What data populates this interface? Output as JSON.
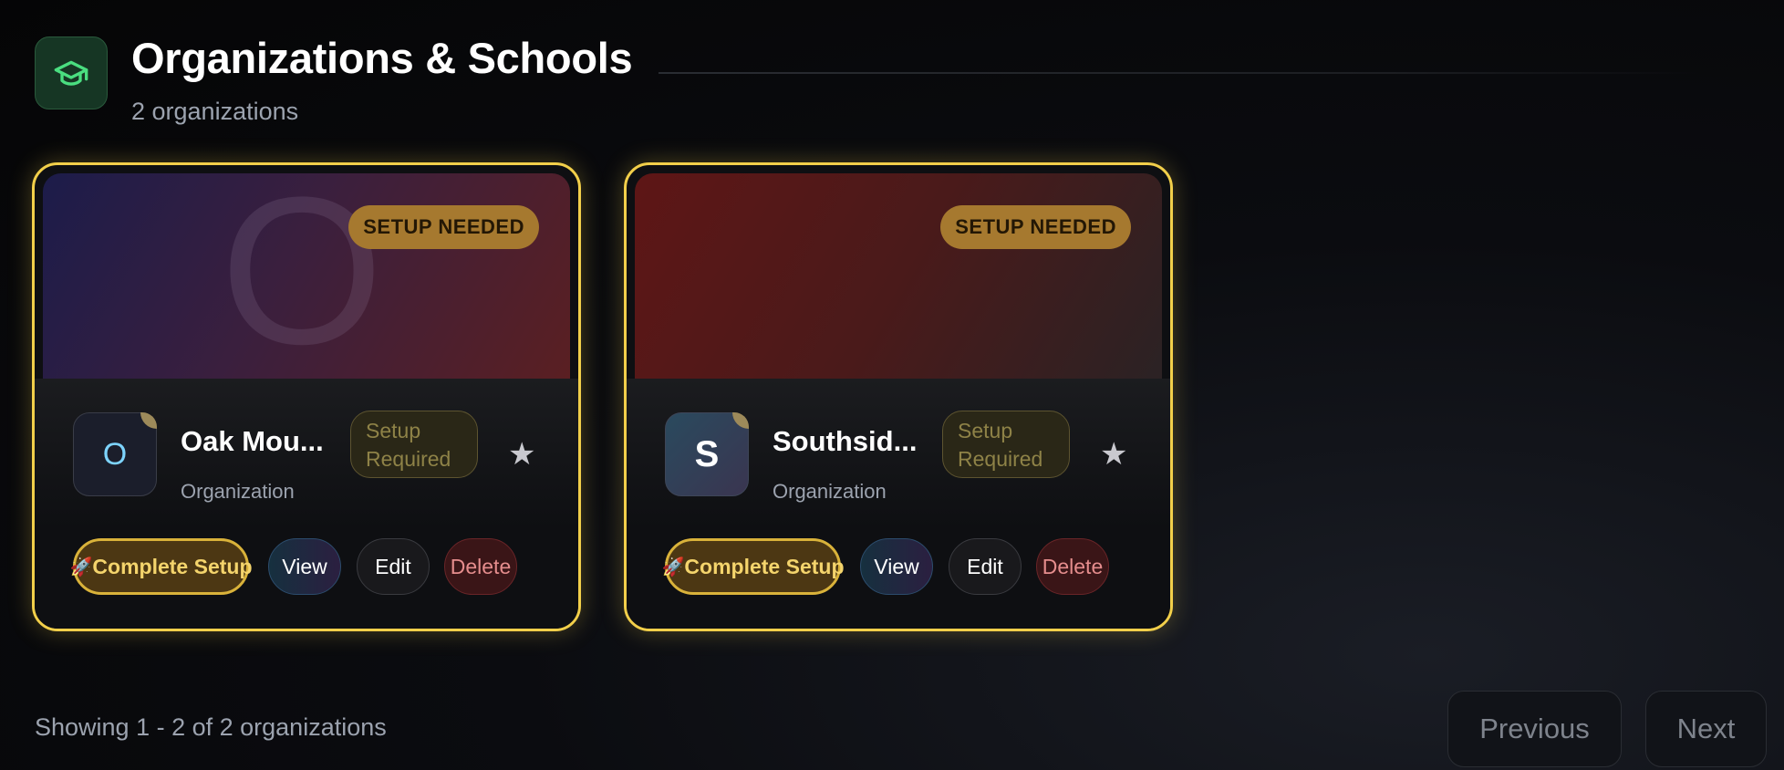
{
  "header": {
    "icon": "graduation-cap-icon",
    "title": "Organizations & Schools",
    "subtitle": "2 organizations"
  },
  "cards": [
    {
      "banner_letter": "O",
      "banner_badge": "SETUP NEEDED",
      "avatar_letter": "O",
      "name": "Oak Mou...",
      "type": "Organization",
      "status_line1": "Setup",
      "status_line2": "Required",
      "favorite_icon": "star-icon",
      "actions": {
        "complete_icon": "🚀",
        "complete": "Complete Setup",
        "view": "View",
        "edit": "Edit",
        "delete": "Delete"
      }
    },
    {
      "banner_letter": "",
      "banner_badge": "SETUP NEEDED",
      "avatar_letter": "S",
      "name": "Southsid...",
      "type": "Organization",
      "status_line1": "Setup",
      "status_line2": "Required",
      "favorite_icon": "star-icon",
      "actions": {
        "complete_icon": "🚀",
        "complete": "Complete Setup",
        "view": "View",
        "edit": "Edit",
        "delete": "Delete"
      }
    }
  ],
  "pagination": {
    "summary": "Showing 1 - 2 of 2 organizations",
    "previous": "Previous",
    "next": "Next"
  },
  "colors": {
    "accent_gold": "#f2cf4a",
    "badge_bg": "#a6792f",
    "header_icon_green": "#4ade80"
  }
}
